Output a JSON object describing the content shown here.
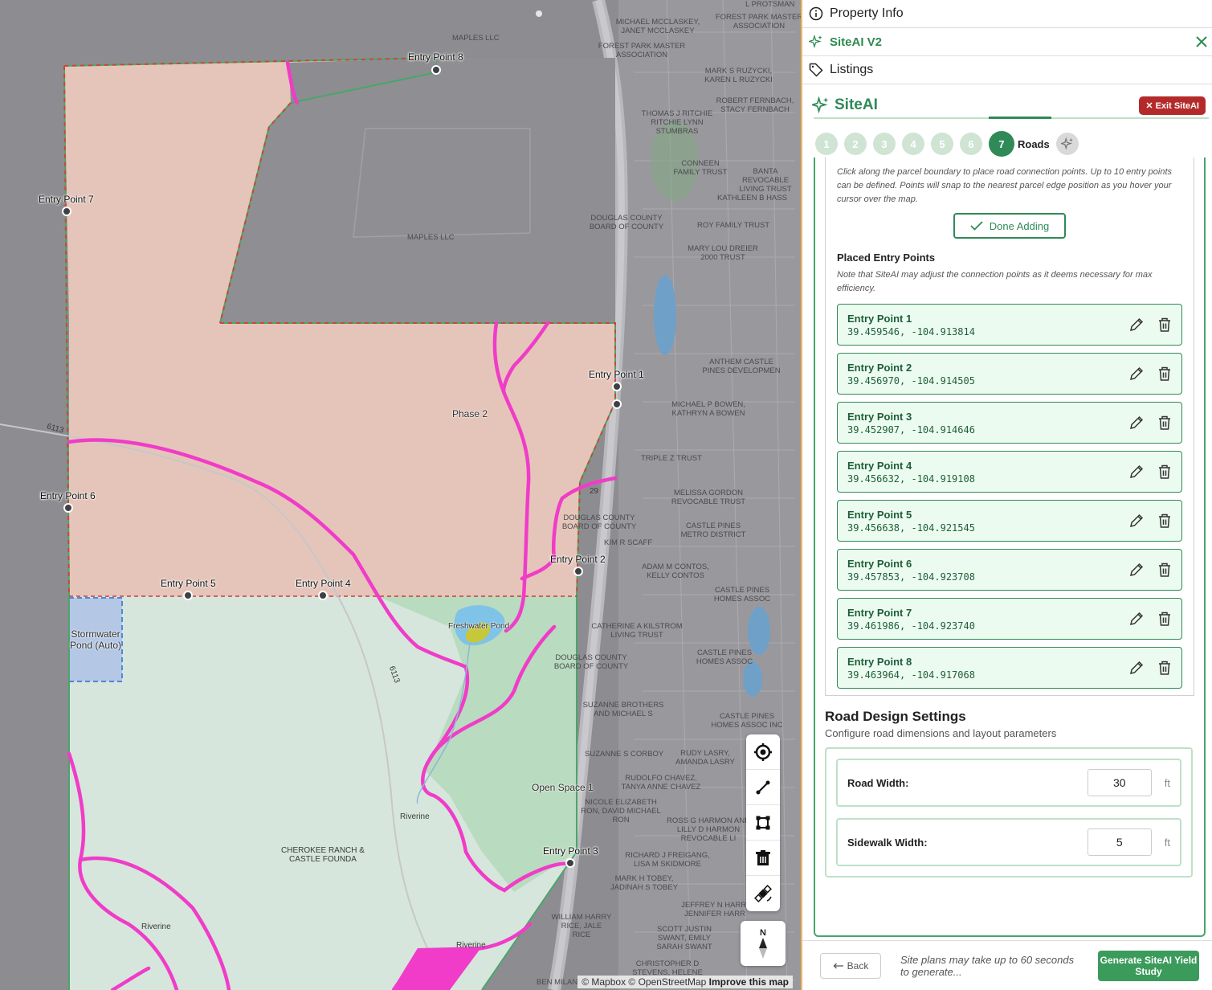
{
  "map": {
    "entry_points": [
      {
        "label": "Entry Point 1"
      },
      {
        "label": "Entry Point 2"
      },
      {
        "label": "Entry Point 3"
      },
      {
        "label": "Entry Point 4"
      },
      {
        "label": "Entry Point 5"
      },
      {
        "label": "Entry Point 6"
      },
      {
        "label": "Entry Point 7"
      },
      {
        "label": "Entry Point 8"
      }
    ],
    "zones": {
      "phase2": "Phase 2",
      "open_space": "Open Space 1",
      "pond": "Freshwater Pond",
      "stormwater": "Stormwater Pond (Auto)"
    },
    "labels": {
      "maples1": "MAPLES LLC",
      "maples2": "MAPLES LLC",
      "mcclaskey": "MICHAEL MCCLASKEY, JANET MCCLASKEY",
      "forest_master": "FOREST PARK MASTER ASSOCIATION",
      "forest_assoc": "FOREST PARK MASTER ASSOCIATION",
      "ruzycki": "MARK S RUZYCKI, KAREN L RUZYCKI",
      "ritchie": "THOMAS J RITCHIE RITCHIE LYNN STUMBRAS",
      "fernbach": "ROBERT FERNBACH, STACY FERNBACH",
      "douglas1": "DOUGLAS COUNTY BOARD OF COUNTY",
      "douglas2": "DOUGLAS COUNTY BOARD OF COUNTY",
      "douglas3": "DOUGLAS COUNTY BOARD OF COUNTY",
      "conneen": "CONNEEN FAMILY TRUST",
      "banta": "BANTA REVOCABLE LIVING TRUST",
      "hass": "KATHLEEN B HASS",
      "roy": "ROY FAMILY TRUST",
      "dreier": "MARY LOU DREIER 2000 TRUST",
      "anthem": "ANTHEM CASTLE PINES DEVELOPMEN",
      "bowen": "MICHAEL P BOWEN, KATHRYN A BOWEN",
      "triple": "TRIPLE Z TRUST",
      "gordon": "MELISSA GORDON REVOCABLE TRUST",
      "metro": "CASTLE PINES METRO DISTRICT",
      "scaff": "KIM R SCAFF",
      "contos": "ADAM M CONTOS, KELLY CONTOS",
      "cph1": "CASTLE PINES HOMES ASSOC",
      "kilstrom": "CATHERINE A KILSTROM LIVING TRUST",
      "cph2": "CASTLE PINES HOMES ASSOC",
      "suzanne_bros": "SUZANNE BROTHERS AND MICHAEL S",
      "cph3": "CASTLE PINES HOMES ASSOC INC",
      "corboy": "SUZANNE S CORBOY",
      "lasry": "RUDY LASRY, AMANDA LASRY",
      "chavez": "RUDOLFO CHAVEZ, TANYA ANNE CHAVEZ",
      "ron": "NICOLE ELIZABETH RON, DAVID MICHAEL RON",
      "harmon": "ROSS G HARMON AND LILLY D HARMON REVOCABLE LI",
      "freigang": "RICHARD J FREIGANG, LISA M SKIDMORE",
      "tobey": "MARK H TOBEY, JADINAH S TOBEY",
      "harr": "JEFFREY N HARR, JENNIFER HARR",
      "rice": "WILLIAM HARRY RICE, JALE RICE",
      "swant": "SCOTT JUSTIN SWANT, EMILY SARAH SWANT",
      "stevens": "CHRISTOPHER D STEVENS, HELENE STEVENS",
      "milan": "BEN MILAN",
      "cherokee": "CHEROKEE RANCH & CASTLE FOUNDA",
      "riverine1": "Riverine",
      "riverine2": "Riverine",
      "riverine3": "Riverine",
      "road6113a": "6113",
      "road6113b": "6113",
      "road29": "29",
      "protsman": "L PROTSMAN"
    },
    "compass": "N",
    "attribution_prefix": "© Mapbox © OpenStreetMap",
    "attribution_link": "Improve this map"
  },
  "panel": {
    "property_info": "Property Info",
    "siteai_v2": "SiteAI V2",
    "listings": "Listings",
    "siteai_title": "SiteAI",
    "exit_label": "✕ Exit SiteAI",
    "steps": [
      "1",
      "2",
      "3",
      "4",
      "5",
      "6",
      "7"
    ],
    "active_step_label": "Roads",
    "instructions": "Click along the parcel boundary to place road connection points. Up to 10 entry points can be defined. Points will snap to the nearest parcel edge position as you hover your cursor over the map.",
    "done_adding": "Done Adding",
    "placed_title": "Placed Entry Points",
    "placed_note": "Note that SiteAI may adjust the connection points as it deems necessary for max efficiency.",
    "entries": [
      {
        "name": "Entry Point 1",
        "coords": "39.459546, -104.913814"
      },
      {
        "name": "Entry Point 2",
        "coords": "39.456970, -104.914505"
      },
      {
        "name": "Entry Point 3",
        "coords": "39.452907, -104.914646"
      },
      {
        "name": "Entry Point 4",
        "coords": "39.456632, -104.919108"
      },
      {
        "name": "Entry Point 5",
        "coords": "39.456638, -104.921545"
      },
      {
        "name": "Entry Point 6",
        "coords": "39.457853, -104.923708"
      },
      {
        "name": "Entry Point 7",
        "coords": "39.461986, -104.923740"
      },
      {
        "name": "Entry Point 8",
        "coords": "39.463964, -104.917068"
      }
    ],
    "road_title": "Road Design Settings",
    "road_sub": "Configure road dimensions and layout parameters",
    "road_width_label": "Road Width:",
    "road_width_value": "30",
    "sidewalk_label": "Sidewalk Width:",
    "sidewalk_value": "5",
    "unit": "ft",
    "back": "Back",
    "footer_note": "Site plans may take up to 60 seconds to generate...",
    "generate": "Generate SiteAI Yield Study"
  },
  "colors": {
    "accent": "#2f8a57",
    "exit": "#b42a2a",
    "road": "#f03cc8",
    "parcel_fill": "#e8c7bd",
    "open_space": "#c7e6ca"
  }
}
